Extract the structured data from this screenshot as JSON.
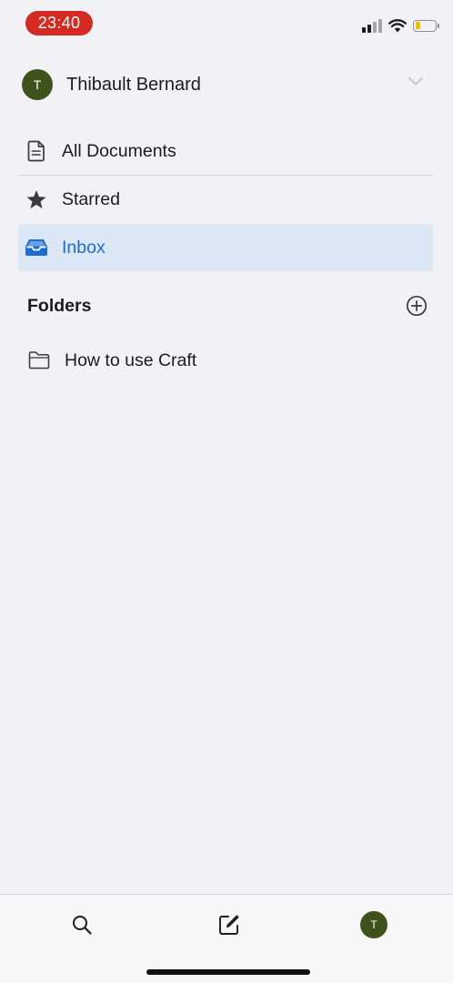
{
  "status_bar": {
    "time": "23:40",
    "icons": [
      "cellular-signal-icon",
      "wifi-icon",
      "battery-icon"
    ],
    "time_pill_color": "#d42a21"
  },
  "account": {
    "avatar_initial": "T",
    "name": "Thibault Bernard",
    "avatar_color": "#3e531c"
  },
  "nav": {
    "items": [
      {
        "label": "All Documents",
        "icon": "document-icon",
        "selected": false
      },
      {
        "label": "Starred",
        "icon": "star-icon",
        "selected": false
      },
      {
        "label": "Inbox",
        "icon": "inbox-tray-icon",
        "selected": true
      }
    ],
    "selected_color": "#1d6dd0",
    "selected_background": "#dbe7f5"
  },
  "folders": {
    "title": "Folders",
    "add_icon": "plus-circle-icon",
    "items": [
      {
        "label": "How to use Craft",
        "icon": "folder-icon"
      }
    ]
  },
  "tab_bar": {
    "items": [
      "search-icon",
      "compose-icon",
      "profile-avatar"
    ],
    "avatar_initial": "T"
  }
}
